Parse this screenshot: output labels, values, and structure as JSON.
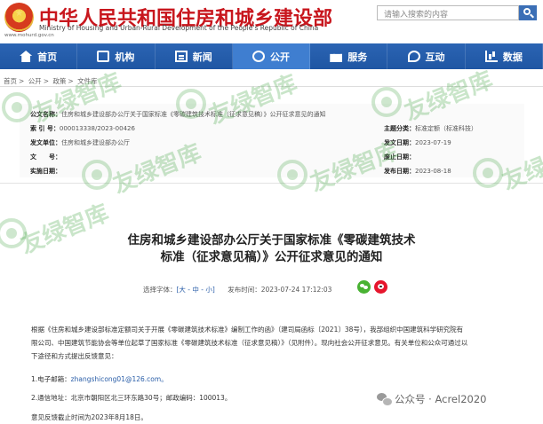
{
  "header": {
    "site_title": "中华人民共和国住房和城乡建设部",
    "site_subtitle": "Ministry of Housing and Urban-Rural Development of the People's Republic of China",
    "domain": "www.mohurd.gov.cn",
    "search_placeholder": "请输入搜索的内容"
  },
  "nav": {
    "items": [
      {
        "label": "首页",
        "icon": "home-icon"
      },
      {
        "label": "机构",
        "icon": "org-icon"
      },
      {
        "label": "新闻",
        "icon": "news-icon"
      },
      {
        "label": "公开",
        "icon": "open-icon"
      },
      {
        "label": "服务",
        "icon": "service-icon"
      },
      {
        "label": "互动",
        "icon": "interact-icon"
      },
      {
        "label": "数据",
        "icon": "data-icon"
      }
    ],
    "active": "公开"
  },
  "breadcrumb": [
    "首页",
    "公开",
    "政策",
    "文件库"
  ],
  "info": {
    "index_label": "公文名称：",
    "index_value": "住房和城乡建设部办公厅关于国家标准《零碳建筑技术标准（征求意见稿）》公开征求意见的通知",
    "number_label": "索 引 号：",
    "number_value": "000013338/2023-00426",
    "issuer_label": "发文单位：",
    "issuer_value": "住房和城乡建设部办公厅",
    "doc_no_label": "文　　号：",
    "doc_no_value": "",
    "impl_label": "实施日期：",
    "impl_value": "",
    "category_label": "主题分类：",
    "category_value": "标准定额（标准科技）",
    "date_label": "发文日期：",
    "date_value": "2023-07-19",
    "effect_label": "废止日期：",
    "effect_value": "",
    "publish_label": "发布日期：",
    "publish_value": "2023-08-18"
  },
  "watermark": "友绿智库",
  "article": {
    "title_line1": "住房和城乡建设部办公厅关于国家标准《零碳建筑技术",
    "title_line2": "标准（征求意见稿）》公开征求意见的通知",
    "font_size_label": "选择字体：",
    "font_size_options": "[大 - 中 - 小]",
    "datetime": "发布时间：2023-07-24 17:12:03",
    "para1_line1": "根据《住房和城乡建设部标准定额司关于开展《零碳建筑技术标准》编制工作的函》（建司局函标〔2021〕38号），我部组织中国建筑科学研究院有",
    "para1_line2": "限公司、中国建筑节能协会等单位起草了国家标准《零碳建筑技术标准（征求意见稿）》（见附件）。现向社会公开征求意见。有关单位和公众可通过以",
    "para1_line3": "下途径和方式提出反馈意见：",
    "item1_prefix": "1.电子邮箱：",
    "item1_value": "zhangshicong01@126.com。",
    "item2": "2.通信地址：北京市朝阳区北三环东路30号；邮政编码：100013。",
    "deadline": "意见反馈截止时间为2023年8月18日。"
  },
  "wechat_badge": "公众号 · Acrel2020",
  "colors": {
    "brand_red": "#c8161d",
    "nav_blue": "#1f56a3",
    "watermark_green": "#3ca03c"
  }
}
